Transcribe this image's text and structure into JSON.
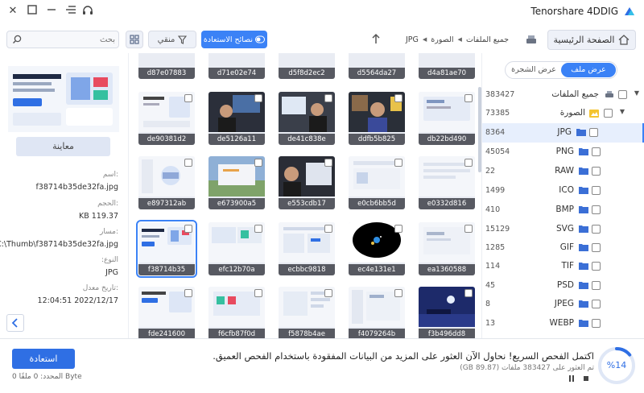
{
  "app": {
    "title": "Tenorshare 4DDIG"
  },
  "toolbar": {
    "home_label": "الصفحة الرئيسية",
    "tips_label": "نصائح الاستعادة",
    "filter_label": "منقي",
    "search_placeholder": "بحث"
  },
  "breadcrumb": [
    "جميع الملفات",
    "الصورة",
    "JPG"
  ],
  "preview": {
    "button_label": "معاينة",
    "name_label": "اسم:",
    "name_value": "f38714b35de32fa.jpg",
    "size_label": "الحجم:",
    "size_value": "KB 119.37",
    "path_label": "مسار:",
    "path_value": "C:\\Thumb\\f38714b35de32fa.jpg",
    "type_label": ":النوع",
    "type_value": "JPG",
    "date_label": "تاريخ معدل:",
    "date_value": "12:04:51 2022/12/17"
  },
  "view_tabs": {
    "file_view": "عرض ملف",
    "tree_view": "عرض الشجرة"
  },
  "tree": {
    "all_files": {
      "name": "جميع الملفات",
      "count": "383427"
    },
    "image": {
      "name": "الصورة",
      "count": "73385"
    },
    "types": [
      {
        "name": "JPG",
        "count": "8364",
        "active": true
      },
      {
        "name": "PNG",
        "count": "45054"
      },
      {
        "name": "RAW",
        "count": "22"
      },
      {
        "name": "ICO",
        "count": "1499"
      },
      {
        "name": "BMP",
        "count": "410"
      },
      {
        "name": "SVG",
        "count": "15129"
      },
      {
        "name": "GIF",
        "count": "1285"
      },
      {
        "name": "TIF",
        "count": "114"
      },
      {
        "name": "PSD",
        "count": "45"
      },
      {
        "name": "JPEG",
        "count": "8"
      },
      {
        "name": "WEBP",
        "count": "13"
      }
    ]
  },
  "grid": {
    "top_row": [
      "d4a81ae70",
      "d5564da27",
      "d5f8d2ec2",
      "d71e02e74",
      "d87e07883"
    ],
    "rows": [
      [
        "db22bd490",
        "ddfb5b825",
        "de41c838e",
        "de5126a11",
        "de90381d2"
      ],
      [
        "e0332d816",
        "e0cb6bb5d",
        "e553cdb17",
        "e673900a5",
        "e897312ab"
      ],
      [
        "ea1360588",
        "ec4e131e1",
        "ecbbc9818",
        "efc12b70a",
        "f38714b35"
      ],
      [
        "f3b496dd8",
        "f4079264b",
        "f5878b4ae",
        "f6cfb87f0d",
        "fde241600"
      ]
    ]
  },
  "bottom": {
    "recover_label": "استعادة",
    "selected_text": "المحدد: 0 ملفًا 0 Byte",
    "scan_message": "اكتمل الفحص السريع! نحاول الآن العثور على المزيد من البيانات المفقودة باستخدام الفحص العميق.",
    "found_message": "تم العثور على 383427 ملفات (89.87 GB)",
    "progress_label": "%14",
    "progress_value": 14
  }
}
